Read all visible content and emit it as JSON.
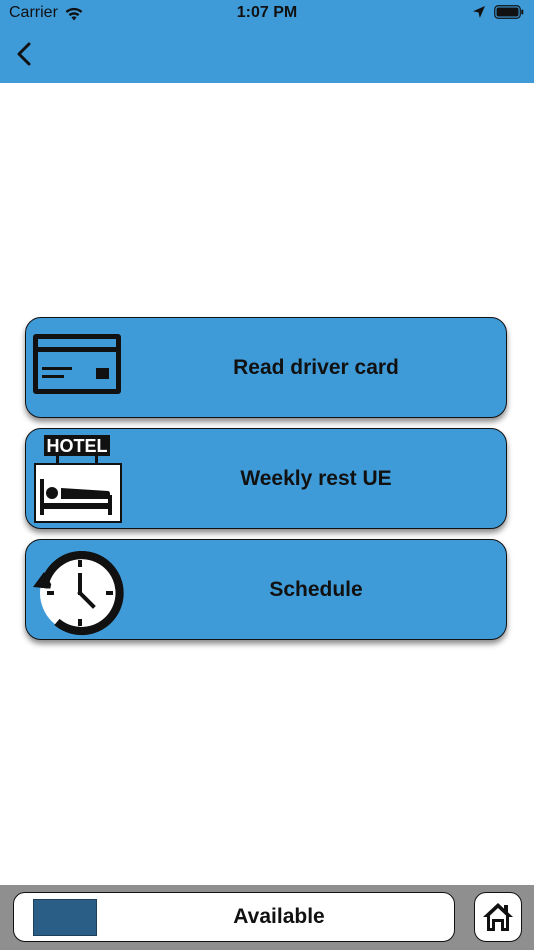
{
  "status_bar": {
    "carrier": "Carrier",
    "time": "1:07 PM",
    "wifi_icon": "wifi-icon",
    "location_icon": "location-arrow-icon",
    "battery_icon": "battery-icon"
  },
  "nav": {
    "back_icon": "chevron-left-icon"
  },
  "menu": {
    "items": [
      {
        "label": "Read driver card",
        "icon": "driver-card-icon"
      },
      {
        "label": "Weekly rest UE",
        "icon": "hotel-bed-icon",
        "icon_text": "HOTEL"
      },
      {
        "label": "Schedule",
        "icon": "clock-refresh-icon"
      }
    ]
  },
  "footer": {
    "status_label": "Available",
    "status_color": "#2a5e86",
    "home_icon": "home-icon"
  },
  "colors": {
    "accent": "#3f9bd8",
    "footer_bg": "#8f8f8f"
  }
}
